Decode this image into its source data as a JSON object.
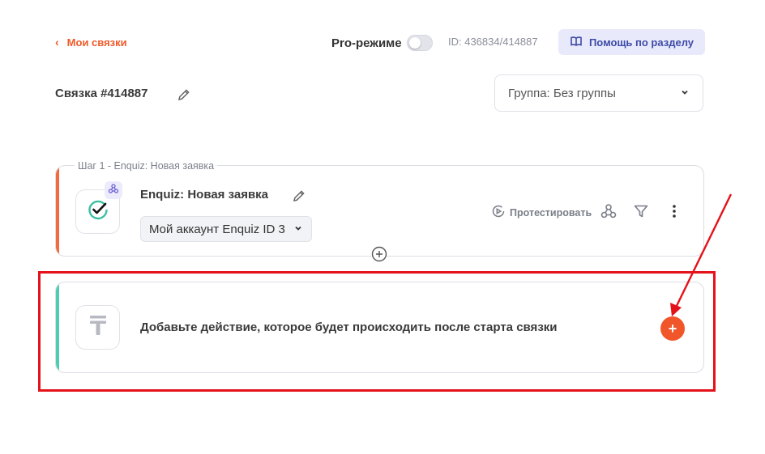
{
  "header": {
    "back_label": "Мои связки",
    "pro_mode_label": "Pro-режиме",
    "pro_mode_enabled": false,
    "id_text": "ID: 436834/414887",
    "help_label": "Помощь по разделу"
  },
  "link": {
    "title": "Связка #414887",
    "group_select": "Группа: Без группы"
  },
  "step1": {
    "legend": "Шаг 1 - Enquiz: Новая заявка",
    "name": "Enquiz: Новая заявка",
    "account": "Мой аккаунт Enquiz ID 3",
    "test_label": "Протестировать",
    "accent_color": "#f26a3d"
  },
  "action": {
    "prompt": "Добавьте действие, которое будет происходить после старта связки",
    "add_symbol": "+",
    "accent_color": "#4ecdb0"
  },
  "colors": {
    "brand": "#f05a28",
    "highlight": "#e4121a",
    "help_bg": "#e8eafb"
  },
  "icons": [
    "chevron-left-icon",
    "book-icon",
    "pencil-icon",
    "chevron-down-icon",
    "check-circle-icon",
    "webhook-icon",
    "play-circle-icon",
    "filter-icon",
    "more-vertical-icon",
    "plus-circle-icon",
    "text-tool-icon",
    "plus-icon"
  ]
}
